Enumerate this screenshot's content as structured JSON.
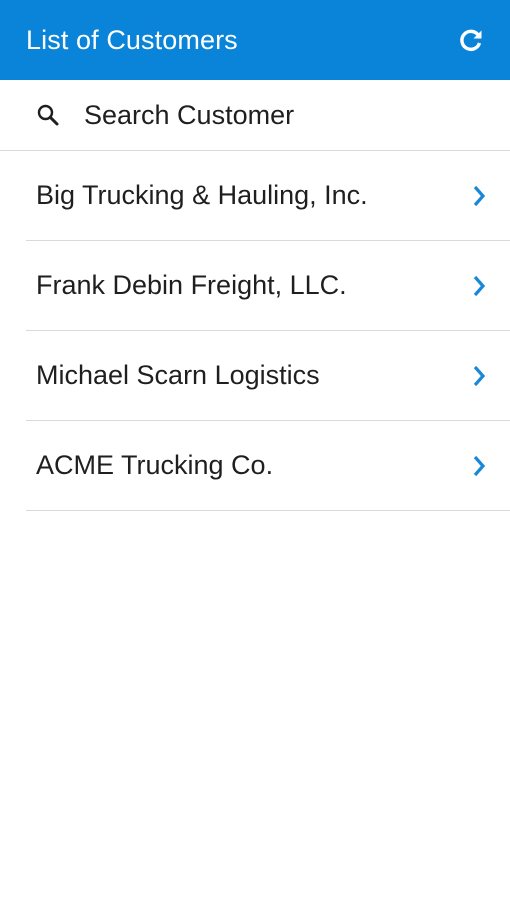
{
  "header": {
    "title": "List of Customers",
    "refresh_icon": "refresh-icon",
    "background_color": "#0a84d8"
  },
  "search": {
    "placeholder": "Search Customer",
    "value": "",
    "icon": "search-icon"
  },
  "customers": [
    {
      "name": "Big Trucking & Hauling, Inc.",
      "icon": "chevron-right-icon"
    },
    {
      "name": "Frank Debin Freight, LLC.",
      "icon": "chevron-right-icon"
    },
    {
      "name": "Michael Scarn Logistics",
      "icon": "chevron-right-icon"
    },
    {
      "name": "ACME Trucking Co.",
      "icon": "chevron-right-icon"
    }
  ],
  "colors": {
    "accent": "#0a84d8",
    "chevron": "#1a88d6",
    "divider": "#d9d9d9"
  }
}
